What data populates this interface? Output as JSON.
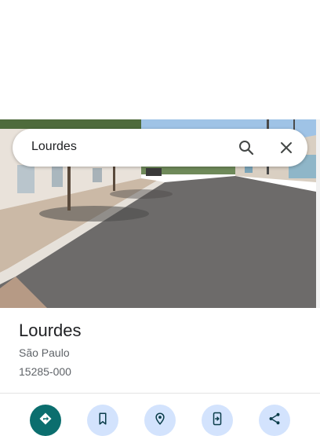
{
  "search": {
    "query": "Lourdes"
  },
  "place": {
    "name": "Lourdes",
    "region": "São Paulo",
    "postal_code": "15285-000"
  },
  "actions": [
    {
      "icon": "directions-icon"
    },
    {
      "icon": "bookmark-icon"
    },
    {
      "icon": "nearby-icon"
    },
    {
      "icon": "send-to-phone-icon"
    },
    {
      "icon": "share-icon"
    }
  ],
  "colors": {
    "primary_action": "#0b6e6e",
    "secondary_action": "#d3e3fd",
    "icon": "#0b3d4a",
    "text_primary": "#202124",
    "text_secondary": "#5f6368"
  }
}
